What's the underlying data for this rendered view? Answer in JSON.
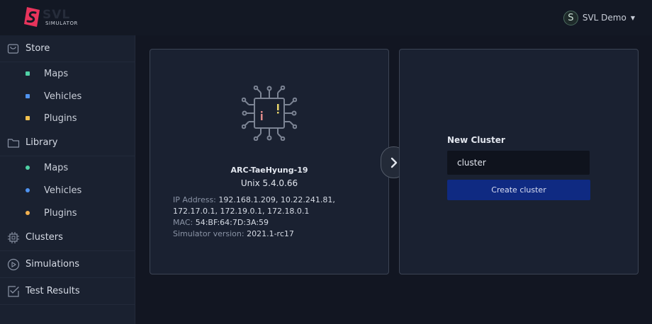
{
  "header": {
    "logo_text": "SVL",
    "logo_subtitle": "SIMULATOR",
    "user_initial": "S",
    "user_name": "SVL Demo",
    "brand_color": "#e8345c"
  },
  "sidebar": {
    "store": {
      "label": "Store",
      "icon": "shopping-bag-icon"
    },
    "store_items": [
      {
        "label": "Maps",
        "color": "#4fd1a5"
      },
      {
        "label": "Vehicles",
        "color": "#4f93f0"
      },
      {
        "label": "Plugins",
        "color": "#f2c14f"
      }
    ],
    "library": {
      "label": "Library",
      "icon": "folder-icon"
    },
    "library_items": [
      {
        "label": "Maps",
        "color": "#4fd1a5"
      },
      {
        "label": "Vehicles",
        "color": "#4f93f0"
      },
      {
        "label": "Plugins",
        "color": "#f2b04f"
      }
    ],
    "clusters": {
      "label": "Clusters",
      "icon": "chip-icon"
    },
    "simulations": {
      "label": "Simulations",
      "icon": "play-circle-icon"
    },
    "test_results": {
      "label": "Test Results",
      "icon": "checklist-icon"
    }
  },
  "machine": {
    "hostname": "ARC-TaeHyung-19",
    "os": "Unix 5.4.0.66",
    "ip_label": "IP Address:",
    "ip_value_line1": "192.168.1.209, 10.22.241.81,",
    "ip_value_line2": "172.17.0.1, 172.19.0.1, 172.18.0.1",
    "mac_label": "MAC:",
    "mac_value": "54:BF:64:7D:3A:59",
    "version_label": "Simulator version:",
    "version_value": "2021.1-rc17"
  },
  "cluster": {
    "title": "New Cluster",
    "input_value": "cluster",
    "create_label": "Create cluster"
  }
}
